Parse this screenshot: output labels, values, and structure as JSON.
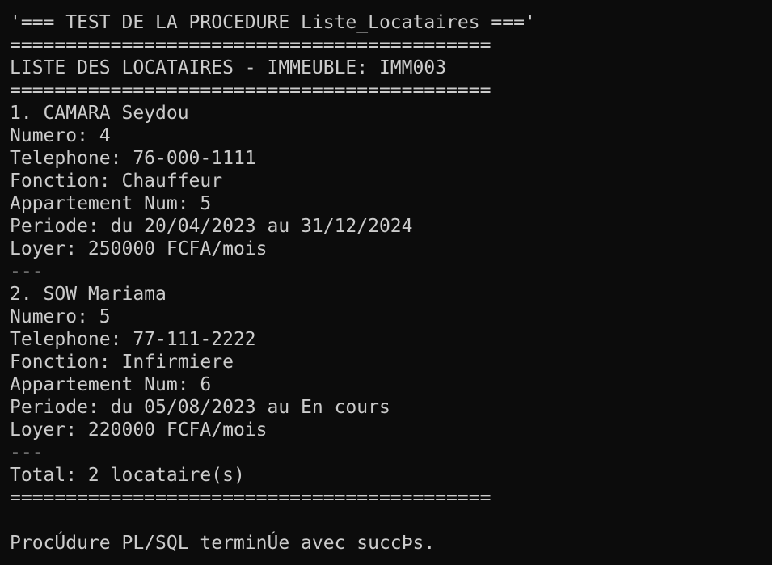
{
  "colors": {
    "background": "#0c0c0c",
    "foreground": "#cccccc"
  },
  "terminal": {
    "lines": [
      "'=== TEST DE LA PROCEDURE Liste_Locataires ==='",
      "===========================================",
      "LISTE DES LOCATAIRES - IMMEUBLE: IMM003",
      "===========================================",
      "1. CAMARA Seydou",
      "Numero: 4",
      "Telephone: 76-000-1111",
      "Fonction: Chauffeur",
      "Appartement Num: 5",
      "Periode: du 20/04/2023 au 31/12/2024",
      "Loyer: 250000 FCFA/mois",
      "---",
      "2. SOW Mariama",
      "Numero: 5",
      "Telephone: 77-111-2222",
      "Fonction: Infirmiere",
      "Appartement Num: 6",
      "Periode: du 05/08/2023 au En cours",
      "Loyer: 220000 FCFA/mois",
      "---",
      "Total: 2 locataire(s)",
      "===========================================",
      "",
      "ProcÚdure PL/SQL terminÚe avec succÞs."
    ]
  }
}
